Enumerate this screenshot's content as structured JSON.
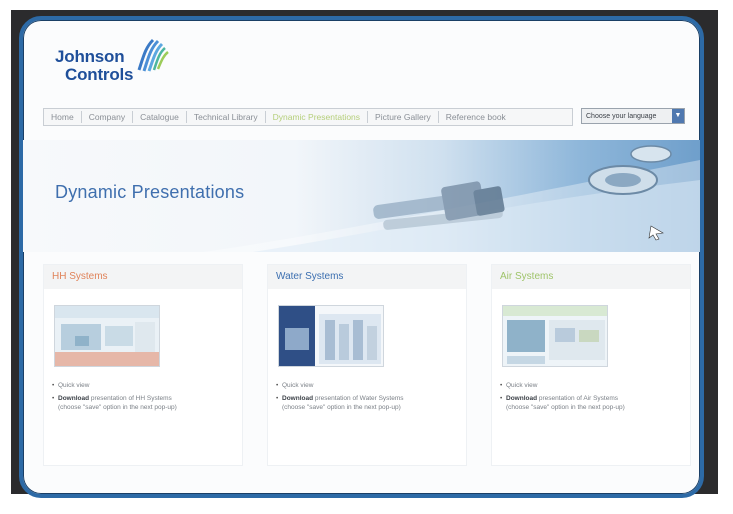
{
  "logo": {
    "line1": "Johnson",
    "line2": "Controls"
  },
  "nav": {
    "items": [
      {
        "label": "Home",
        "active": false
      },
      {
        "label": "Company",
        "active": false
      },
      {
        "label": "Catalogue",
        "active": false
      },
      {
        "label": "Technical Library",
        "active": false
      },
      {
        "label": "Dynamic Presentations",
        "active": true
      },
      {
        "label": "Picture Gallery",
        "active": false
      },
      {
        "label": "Reference book",
        "active": false
      }
    ]
  },
  "language": {
    "label": "Choose your language",
    "arrow": "▼"
  },
  "banner": {
    "title": "Dynamic Presentations"
  },
  "cards": [
    {
      "title": "HH Systems",
      "title_color": "#e0835a",
      "quick_view": "Quick view",
      "download_bold": "Download",
      "download_text": "presentation of HH Systems",
      "download_note": "(choose \"save\" option in the next pop-up)"
    },
    {
      "title": "Water Systems",
      "title_color": "#3c6fb0",
      "quick_view": "Quick view",
      "download_bold": "Download",
      "download_text": "presentation of Water Systems",
      "download_note": "(choose \"save\" option in the next pop-up)"
    },
    {
      "title": "Air Systems",
      "title_color": "#9fc46a",
      "quick_view": "Quick view",
      "download_bold": "Download",
      "download_text": "presentation of Air Systems",
      "download_note": "(choose \"save\" option in the next pop-up)"
    }
  ],
  "colors": {
    "frame_border": "#2d6aa6",
    "brand": "#1f4f9a",
    "nav_active": "#b5cf7a"
  }
}
